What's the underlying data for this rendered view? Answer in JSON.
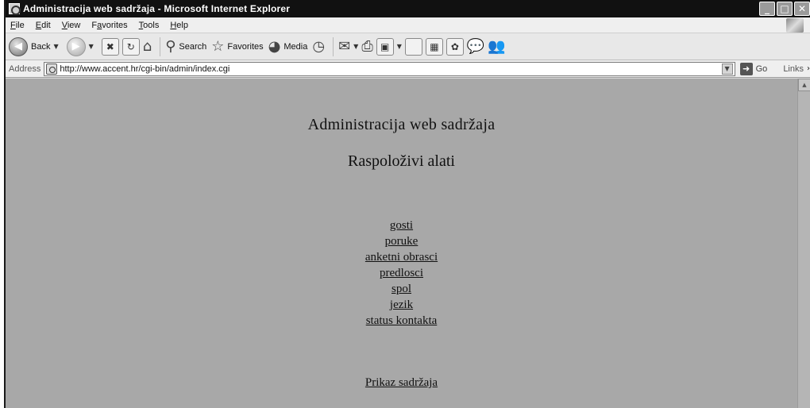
{
  "window": {
    "title": "Administracija web sadržaja - Microsoft Internet Explorer",
    "buttons": {
      "minimize": "_",
      "maximize": "□",
      "close": "✕"
    }
  },
  "menu": {
    "items": [
      {
        "key": "F",
        "rest": "ile"
      },
      {
        "key": "E",
        "rest": "dit"
      },
      {
        "key": "V",
        "rest": "iew"
      },
      {
        "pre": "F",
        "key": "a",
        "rest": "vorites"
      },
      {
        "key": "T",
        "rest": "ools"
      },
      {
        "key": "H",
        "rest": "elp"
      }
    ]
  },
  "toolbar": {
    "back_label": "Back",
    "search_label": "Search",
    "favorites_label": "Favorites",
    "media_label": "Media"
  },
  "address": {
    "label": "Address",
    "url": "http://www.accent.hr/cgi-bin/admin/index.cgi",
    "go_label": "Go",
    "links_label": "Links"
  },
  "page": {
    "heading": "Administracija web sadržaja",
    "subheading": "Raspoloživi alati",
    "links": [
      "gosti",
      "poruke",
      "anketni obrasci",
      "predlosci",
      "spol",
      "jezik",
      "status kontakta"
    ],
    "bottom_link": "Prikaz sadržaja"
  },
  "icons": {
    "back": "back-arrow-icon",
    "forward": "forward-arrow-icon",
    "stop": "stop-icon",
    "refresh": "refresh-icon",
    "home": "home-icon",
    "search": "search-icon",
    "favorites": "star-icon",
    "media": "media-icon",
    "history": "history-icon",
    "mail": "mail-icon",
    "print": "print-icon"
  }
}
